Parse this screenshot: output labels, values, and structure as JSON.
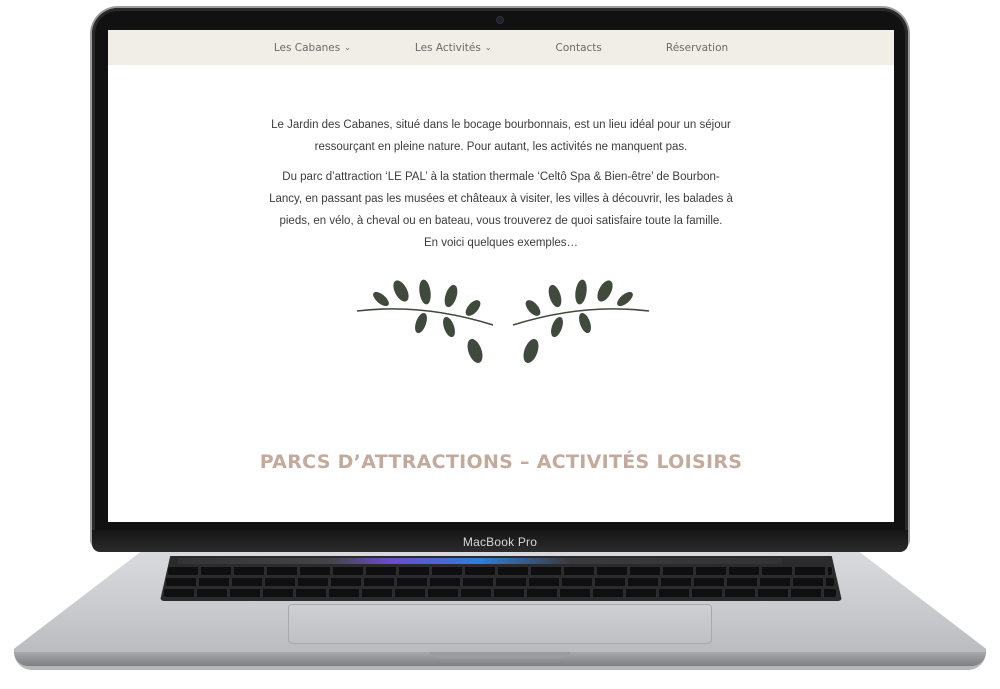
{
  "device": {
    "brand": "MacBook Pro"
  },
  "nav": {
    "items": [
      {
        "label": "Les Cabanes",
        "has_dropdown": true
      },
      {
        "label": "Les Activités",
        "has_dropdown": true
      },
      {
        "label": "Contacts",
        "has_dropdown": false
      },
      {
        "label": "Réservation",
        "has_dropdown": false
      }
    ]
  },
  "main": {
    "intro_line1": "Le Jardin des Cabanes, situé dans le bocage bourbonnais, est un lieu idéal pour un séjour",
    "intro_line2": "ressourçant en pleine nature. Pour autant, les activités ne manquent pas.",
    "details_line1": "Du parc d’attraction ‘LE PAL’ à la station thermale ‘Celtô Spa & Bien-être’ de Bourbon-",
    "details_line2": "Lancy, en passant pas les musées et châteaux à visiter, les villes à découvrir, les balades à",
    "details_line3": "pieds, en vélo, à cheval ou en bateau, vous trouverez de quoi satisfaire toute la famille.",
    "details_line4": "En voici quelques exemples…",
    "section_title": "PARCS D’ATTRACTIONS – ACTIVITÉS LOISIRS"
  },
  "colors": {
    "nav_bg": "#f1ede7",
    "leaf": "#3f4a3c",
    "title": "#c4aa9c",
    "body_text": "#3c3c3c"
  },
  "icons": {
    "divider": "olive-branch-icon",
    "dropdown": "chevron-down-icon"
  }
}
